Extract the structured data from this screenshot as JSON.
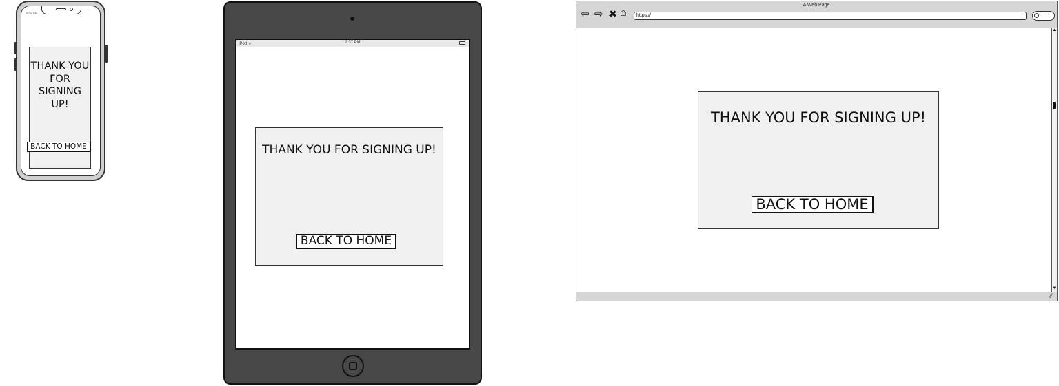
{
  "phone": {
    "status_time": "10:52 AM",
    "title": "THANK YOU FOR SIGNING UP!",
    "button_label": "BACK TO HOME"
  },
  "tablet": {
    "carrier": "iPod ᯤ",
    "time": "2:37 PM",
    "title": "THANK YOU FOR SIGNING UP!",
    "button_label": "BACK TO HOME"
  },
  "browser": {
    "window_title": "A Web Page",
    "url": "https://",
    "nav_icons": [
      "back-arrow-icon",
      "forward-arrow-icon",
      "stop-icon",
      "home-icon"
    ],
    "nav_glyphs": {
      "back": "⇦",
      "forward": "⇨",
      "stop": "✖",
      "home": "⌂"
    },
    "title": "THANK YOU FOR SIGNING UP!",
    "button_label": "BACK TO HOME"
  },
  "colors": {
    "device_frame": "#484848",
    "card_fill": "#f0f0f0",
    "browser_chrome": "#d6d6d6"
  }
}
